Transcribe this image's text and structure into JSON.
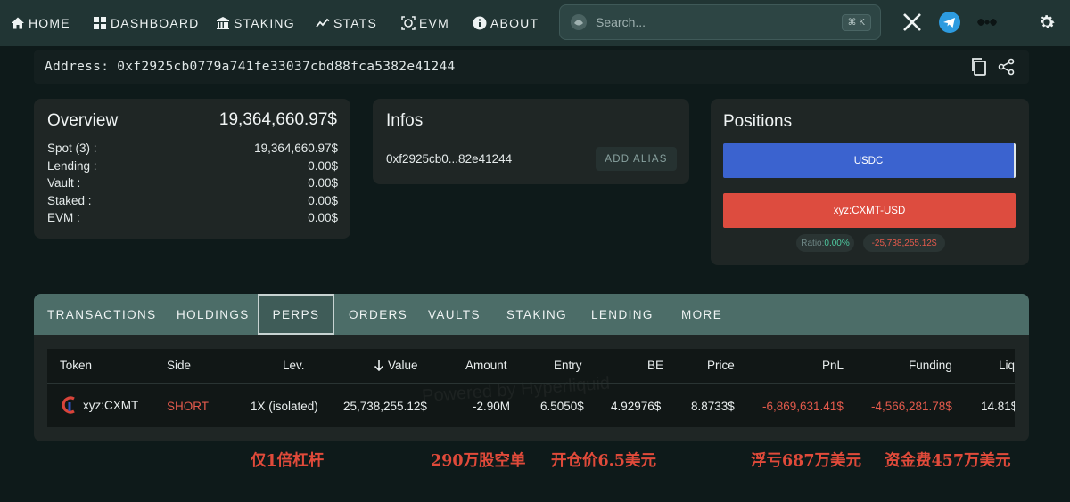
{
  "nav": {
    "items": [
      {
        "label": "HOME",
        "icon": "home-icon"
      },
      {
        "label": "DASHBOARD",
        "icon": "dashboard-icon"
      },
      {
        "label": "STAKING",
        "icon": "bank-icon"
      },
      {
        "label": "STATS",
        "icon": "chart-line-icon"
      },
      {
        "label": "EVM",
        "icon": "evm-icon"
      },
      {
        "label": "ABOUT",
        "icon": "info-icon"
      }
    ],
    "search_placeholder": "Search...",
    "search_shortcut": "⌘ K"
  },
  "address": {
    "text": "Address: 0xf2925cb0779a741fe33037cbd88fca5382e41244"
  },
  "overview": {
    "title": "Overview",
    "total": "19,364,660.97$",
    "rows": [
      {
        "label": "Spot (3) :",
        "value": "19,364,660.97$"
      },
      {
        "label": "Lending :",
        "value": "0.00$"
      },
      {
        "label": "Vault :",
        "value": "0.00$"
      },
      {
        "label": "Staked :",
        "value": "0.00$"
      },
      {
        "label": "EVM :",
        "value": "0.00$"
      }
    ]
  },
  "infos": {
    "title": "Infos",
    "short_address": "0xf2925cb0...82e41244",
    "alias_button": "ADD ALIAS"
  },
  "positions": {
    "title": "Positions",
    "bars": [
      {
        "label": "USDC",
        "color": "#3b63cf"
      },
      {
        "label": "xyz:CXMT-USD",
        "color": "#dd4c3f"
      }
    ],
    "ratio_label": "Ratio:",
    "ratio_value": "0.00%",
    "net_value": "-25,738,255.12$"
  },
  "tabs": [
    "TRANSACTIONS",
    "HOLDINGS",
    "PERPS",
    "ORDERS",
    "VAULTS",
    "STAKING",
    "LENDING",
    "MORE"
  ],
  "active_tab": "PERPS",
  "table": {
    "headers": [
      "Token",
      "Side",
      "Lev.",
      "Value",
      "Amount",
      "Entry",
      "BE",
      "Price",
      "PnL",
      "Funding",
      "Liq"
    ],
    "row": {
      "token": "xyz:CXMT",
      "side": "SHORT",
      "lev": "1X (isolated)",
      "value": "25,738,255.12$",
      "amount": "-2.90M",
      "entry": "6.5050$",
      "be": "4.92976$",
      "price": "8.8733$",
      "pnl": "-6,869,631.41$",
      "funding": "-4,566,281.78$",
      "liq": "14.81$"
    },
    "watermark": "Powered by Hyperliquid"
  },
  "annotations": [
    "仅1倍杠杆",
    "290万股空单",
    "开仓价6.5美元",
    "浮亏687万美元",
    "资金费457万美元"
  ],
  "colors": {
    "accent_red": "#e35a4c",
    "usdc_blue": "#3b63cf",
    "tab_bar": "#4c6d68",
    "nav_bg": "#213534"
  }
}
